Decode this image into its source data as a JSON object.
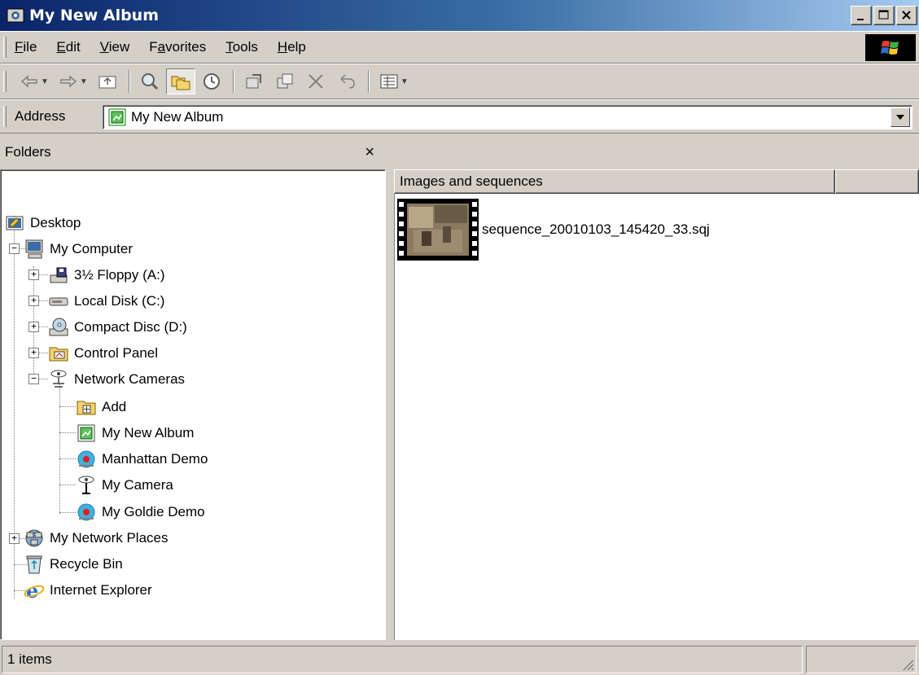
{
  "window": {
    "title": "My New Album"
  },
  "menu": [
    {
      "label": "File",
      "access": "F"
    },
    {
      "label": "Edit",
      "access": "E"
    },
    {
      "label": "View",
      "access": "V"
    },
    {
      "label": "Favorites",
      "access": "a"
    },
    {
      "label": "Tools",
      "access": "T"
    },
    {
      "label": "Help",
      "access": "H"
    }
  ],
  "toolbar": {
    "buttons": [
      "back-icon",
      "forward-icon",
      "up-folder-icon",
      "search-icon",
      "folders-icon",
      "history-icon",
      "move-to-icon",
      "copy-to-icon",
      "delete-icon",
      "undo-icon",
      "views-icon"
    ]
  },
  "address": {
    "label": "Address",
    "value": "My New Album"
  },
  "folders": {
    "title": "Folders",
    "close": "×",
    "tree": [
      {
        "label": "Desktop",
        "icon": "desktop-icon"
      },
      {
        "label": "My Computer",
        "icon": "my-computer-icon"
      },
      {
        "label": "3½ Floppy (A:)",
        "icon": "floppy-icon"
      },
      {
        "label": "Local Disk (C:)",
        "icon": "local-disk-icon"
      },
      {
        "label": "Compact Disc (D:)",
        "icon": "compact-disc-icon"
      },
      {
        "label": "Control Panel",
        "icon": "control-panel-icon"
      },
      {
        "label": "Network Cameras",
        "icon": "network-cameras-icon"
      },
      {
        "label": "Add",
        "icon": "add-icon"
      },
      {
        "label": "My New Album",
        "icon": "album-icon"
      },
      {
        "label": "Manhattan Demo",
        "icon": "demo-camera-icon"
      },
      {
        "label": "My Camera",
        "icon": "camera-icon"
      },
      {
        "label": "My Goldie Demo",
        "icon": "demo-camera-icon"
      },
      {
        "label": "My Network Places",
        "icon": "network-places-icon"
      },
      {
        "label": "Recycle Bin",
        "icon": "recycle-bin-icon"
      },
      {
        "label": "Internet Explorer",
        "icon": "internet-explorer-icon"
      }
    ]
  },
  "content": {
    "column_header": "Images and sequences",
    "files": [
      {
        "name": "sequence_20010103_145420_33.sqj",
        "icon": "film-sequence-icon"
      }
    ]
  },
  "status": {
    "text": "1 items"
  }
}
